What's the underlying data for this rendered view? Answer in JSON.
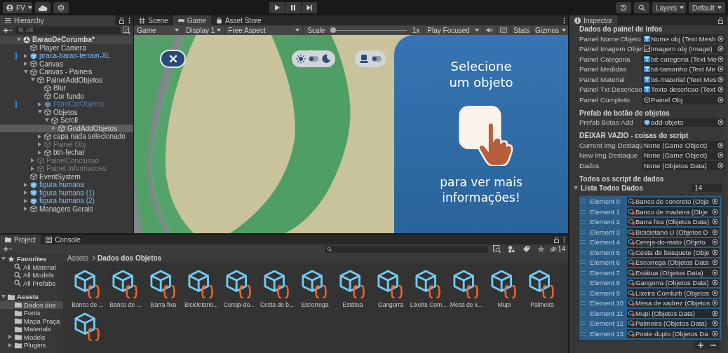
{
  "toolbar": {
    "account": "FV",
    "layers": "Layers",
    "layout": "Default"
  },
  "hierarchy": {
    "title": "Hierarchy",
    "search_placeholder": "All",
    "items": [
      {
        "name": "BaraoDeCorumba*",
        "kind": "scene",
        "active": true,
        "expanded": true,
        "selected": false,
        "overridden": false,
        "children": [
          {
            "name": "Player Camera",
            "kind": "object",
            "active": true,
            "selected": false,
            "overridden": false
          },
          {
            "name": "praca-barao-terrain-XL",
            "kind": "prefab",
            "active": true,
            "expanded": false,
            "selected": false,
            "overridden": true
          },
          {
            "name": "Canvas",
            "kind": "object",
            "active": true,
            "expanded": false,
            "selected": false,
            "overridden": false
          },
          {
            "name": "Canvas - Paineis",
            "kind": "object",
            "active": true,
            "expanded": true,
            "selected": false,
            "overridden": false,
            "children": [
              {
                "name": "PainelAddObjetos",
                "kind": "object",
                "active": true,
                "expanded": true,
                "selected": false,
                "overridden": false,
                "children": [
                  {
                    "name": "Blur",
                    "kind": "object",
                    "active": true,
                    "selected": false,
                    "overridden": false
                  },
                  {
                    "name": "Cor fundo",
                    "kind": "object",
                    "active": true,
                    "selected": false,
                    "overridden": false
                  },
                  {
                    "name": "FiltroCatObjetos",
                    "kind": "prefab",
                    "active": false,
                    "expanded": false,
                    "selected": false,
                    "overridden": true
                  },
                  {
                    "name": "Objetos",
                    "kind": "object",
                    "active": true,
                    "expanded": true,
                    "selected": false,
                    "overridden": false,
                    "children": [
                      {
                        "name": "Scroll",
                        "kind": "object",
                        "active": true,
                        "expanded": true,
                        "selected": false,
                        "overridden": false,
                        "children": [
                          {
                            "name": "GridAddObjetos",
                            "kind": "object",
                            "active": true,
                            "expanded": false,
                            "selected": true,
                            "overridden": false
                          }
                        ]
                      }
                    ]
                  },
                  {
                    "name": "capa nada selecionado",
                    "kind": "object",
                    "active": true,
                    "expanded": false,
                    "selected": false,
                    "overridden": false
                  },
                  {
                    "name": "Painel Obj",
                    "kind": "object",
                    "active": false,
                    "expanded": false,
                    "selected": false,
                    "overridden": false
                  },
                  {
                    "name": "btn-fechar",
                    "kind": "object",
                    "active": true,
                    "expanded": false,
                    "selected": false,
                    "overridden": false
                  }
                ]
              },
              {
                "name": "PainelConclusao",
                "kind": "object",
                "active": false,
                "expanded": false,
                "selected": false,
                "overridden": false
              },
              {
                "name": "Painel-informacoes",
                "kind": "object",
                "active": false,
                "expanded": false,
                "selected": false,
                "overridden": false
              }
            ]
          },
          {
            "name": "EventSystem",
            "kind": "object",
            "active": true,
            "selected": false,
            "overridden": false
          },
          {
            "name": "figura humana",
            "kind": "prefab",
            "active": true,
            "expanded": false,
            "selected": false,
            "overridden": false
          },
          {
            "name": "figura humana (1)",
            "kind": "prefab",
            "active": true,
            "expanded": false,
            "selected": false,
            "overridden": false
          },
          {
            "name": "figura humana (2)",
            "kind": "prefab",
            "active": true,
            "expanded": false,
            "selected": false,
            "overridden": false
          },
          {
            "name": "Managers Gerais",
            "kind": "object",
            "active": true,
            "expanded": false,
            "selected": false,
            "overridden": false
          }
        ]
      }
    ]
  },
  "game": {
    "tabs": [
      {
        "label": "Scene",
        "selected": false
      },
      {
        "label": "Game",
        "selected": true
      },
      {
        "label": "Asset Store",
        "selected": false
      }
    ],
    "toggles": [
      {
        "kind": "theme",
        "on": false
      },
      {
        "kind": "view",
        "on": false
      }
    ],
    "display_mode": "Game",
    "display": "Display 1",
    "aspect": "Free Aspect",
    "scale_label": "Scale",
    "scale": {
      "level": 0
    },
    "scale_value": "1x",
    "play_mode": "Play Focused",
    "stats": "Stats",
    "gizmos": "Gizmos",
    "panel_title": "Selecione um objeto",
    "panel_hint": "para ver mais informações!"
  },
  "inspector": {
    "title": "Inspector",
    "sections": [
      {
        "heading": "Dados do painel de infos",
        "fields": [
          {
            "label": "Painel Nome Objeto",
            "value": "Nome obj (Text Mesh",
            "kind": "text"
          },
          {
            "label": "Painel Imagem Objet",
            "value": "Imagem obj (Image)",
            "kind": "image"
          },
          {
            "label": "Painel Categoria",
            "value": "txt-categoria (Text Me",
            "kind": "text"
          },
          {
            "label": "Painel Medidas",
            "value": "txt-tamanho (Text Me",
            "kind": "text"
          },
          {
            "label": "Painel Material",
            "value": "txt-material (Text Mes",
            "kind": "text"
          },
          {
            "label": "Painel Txt Descricao",
            "value": "Texto descricao (Text",
            "kind": "text"
          },
          {
            "label": "Painel Completo",
            "value": "Painel Obj",
            "kind": "object"
          }
        ]
      },
      {
        "heading": "Prefab do botão de objetos",
        "fields": [
          {
            "label": "Prefab Botao Add",
            "value": "add-objeto",
            "kind": "prefab"
          }
        ]
      },
      {
        "heading": "DEIXAR VAZIO - coisas do script",
        "fields": [
          {
            "label": "Current Img Destaqu",
            "value": "None (Game Object)",
            "kind": "none"
          },
          {
            "label": "New Img Destaque",
            "value": "None (Game Object)",
            "kind": "none"
          },
          {
            "label": "Dados",
            "value": "None (Objetos Data)",
            "kind": "none"
          }
        ]
      }
    ],
    "list": {
      "heading": "Todos os script de dados",
      "label": "Lista Todos Dados",
      "expanded": true,
      "count": "14",
      "elements": [
        {
          "label": "Element 0",
          "value": "Banco de concreto (Obje"
        },
        {
          "label": "Element 1",
          "value": "Banco de madeira (Obje"
        },
        {
          "label": "Element 2",
          "value": "Barra fixa (Objetos Data)"
        },
        {
          "label": "Element 3",
          "value": "Bicicletario U (Objetos D"
        },
        {
          "label": "Element 4",
          "value": "Cereja-do-mato (Objeto"
        },
        {
          "label": "Element 5",
          "value": "Cesta de basquete (Obje"
        },
        {
          "label": "Element 6",
          "value": "Escorrega (Objetos Data"
        },
        {
          "label": "Element 7",
          "value": "Estátua (Objetos Data)"
        },
        {
          "label": "Element 8",
          "value": "Gangorra (Objetos Data)"
        },
        {
          "label": "Element 9",
          "value": "Lixeira Comlurb (Objetos"
        },
        {
          "label": "Element 10",
          "value": "Mesa de xadrez (Objetos"
        },
        {
          "label": "Element 11",
          "value": "Mupi (Objetos Data)"
        },
        {
          "label": "Element 12",
          "value": "Palmeira (Objetos Data)"
        },
        {
          "label": "Element 13",
          "value": "Poste duplo (Objetos Da"
        }
      ]
    }
  },
  "project": {
    "tabs": [
      {
        "label": "Project",
        "selected": true
      },
      {
        "label": "Console",
        "selected": false
      }
    ],
    "hidden_count": "14",
    "favorites": {
      "label": "Favorites",
      "expanded": true,
      "items": [
        "All Material",
        "All Models",
        "All Prefabs"
      ]
    },
    "folders": [
      {
        "name": "Assets",
        "expanded": true,
        "selected": false,
        "children": [
          {
            "name": "Dados dos",
            "selected": true
          },
          {
            "name": "Fonts",
            "selected": false
          },
          {
            "name": "Mapa Praça",
            "selected": false
          },
          {
            "name": "Materials",
            "selected": false
          },
          {
            "name": "Models",
            "expanded": false,
            "selected": false
          },
          {
            "name": "Plugins",
            "expanded": false,
            "selected": false
          }
        ]
      }
    ],
    "breadcrumb": [
      "Assets",
      "Dados dos Objetos"
    ],
    "assets": [
      {
        "label": "Banco de ...",
        "kind": "data"
      },
      {
        "label": "Banco de ...",
        "kind": "data"
      },
      {
        "label": "Barra fixa",
        "kind": "data"
      },
      {
        "label": "Bicicletario...",
        "kind": "data"
      },
      {
        "label": "Cereja-do...",
        "kind": "data"
      },
      {
        "label": "Cesta de b...",
        "kind": "data"
      },
      {
        "label": "Escorrega",
        "kind": "data"
      },
      {
        "label": "Estátua",
        "kind": "data"
      },
      {
        "label": "Gangorra",
        "kind": "data"
      },
      {
        "label": "Lixeira Com...",
        "kind": "data"
      },
      {
        "label": "Mesa de x...",
        "kind": "data"
      },
      {
        "label": "Mupi",
        "kind": "data"
      },
      {
        "label": "Palmeira",
        "kind": "data"
      },
      {
        "kind": "data"
      }
    ]
  }
}
